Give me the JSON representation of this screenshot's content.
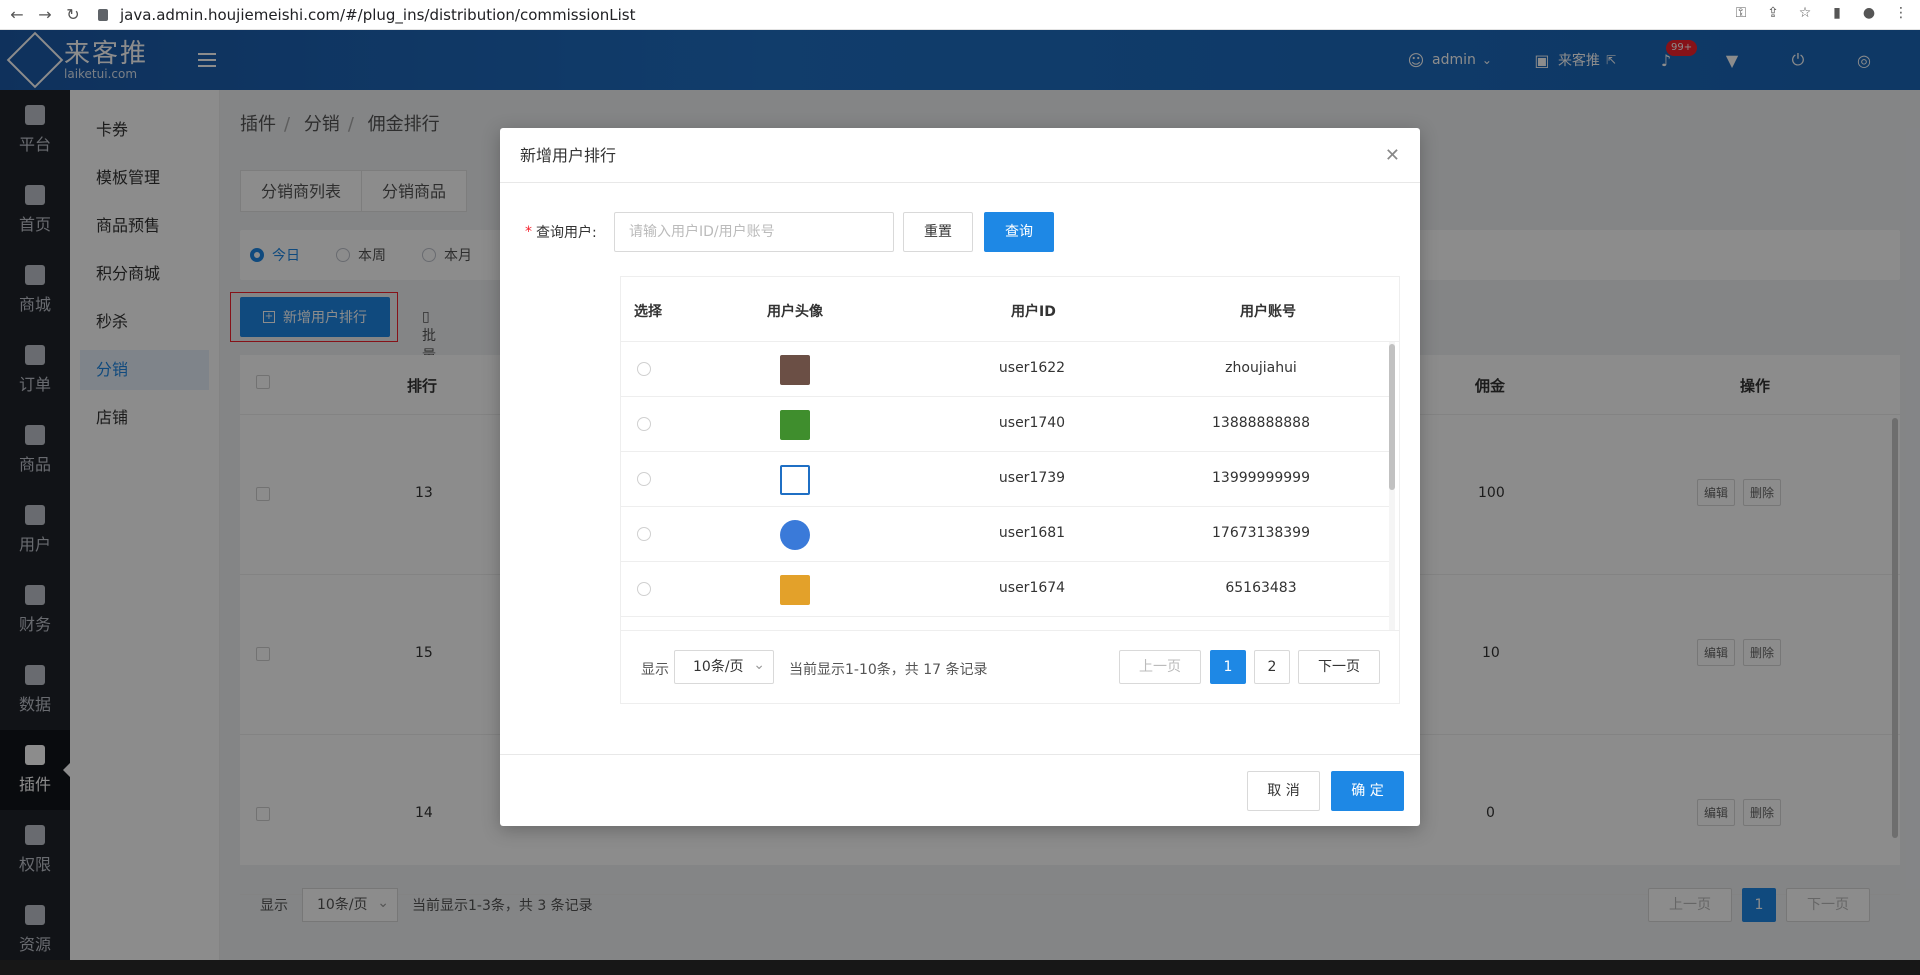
{
  "browser": {
    "url": "java.admin.houjiemeishi.com/#/plug_ins/distribution/commissionList"
  },
  "header": {
    "logo_cn": "来客推",
    "logo_en": "laiketui.com",
    "user": "admin",
    "store": "来客推",
    "notif_badge": "99+"
  },
  "sidebar": {
    "items": [
      {
        "label": "平台",
        "icon": "platform-icon"
      },
      {
        "label": "首页",
        "icon": "home-icon"
      },
      {
        "label": "商城",
        "icon": "mall-icon"
      },
      {
        "label": "订单",
        "icon": "order-icon"
      },
      {
        "label": "商品",
        "icon": "goods-icon"
      },
      {
        "label": "用户",
        "icon": "user-icon"
      },
      {
        "label": "财务",
        "icon": "wallet-icon"
      },
      {
        "label": "数据",
        "icon": "pie-chart-icon"
      },
      {
        "label": "插件",
        "icon": "puzzle-icon"
      },
      {
        "label": "权限",
        "icon": "shield-icon"
      },
      {
        "label": "资源",
        "icon": "image-icon"
      }
    ]
  },
  "submenu": {
    "items": [
      "卡券",
      "模板管理",
      "商品预售",
      "积分商城",
      "秒杀",
      "分销",
      "店铺"
    ]
  },
  "breadcrumb": [
    "插件",
    "分销",
    "佣金排行"
  ],
  "tabs": [
    "分销商列表",
    "分销商品"
  ],
  "filter": [
    "今日",
    "本周",
    "本月"
  ],
  "actions": {
    "add": "新增用户排行",
    "batch_delete": "批量删除"
  },
  "bg_table": {
    "headers": {
      "rank": "排行",
      "commission": "佣金",
      "op": "操作"
    },
    "rows": [
      {
        "rank": "13",
        "commission": "100"
      },
      {
        "rank": "15",
        "commission": "10"
      },
      {
        "rank": "14",
        "commission": "0"
      }
    ],
    "edit": "编辑",
    "delete": "删除"
  },
  "bg_pager": {
    "show": "显示",
    "page_size": "10条/页",
    "info": "当前显示1-3条，共 3 条记录",
    "prev": "上一页",
    "page": "1",
    "next": "下一页"
  },
  "modal": {
    "title": "新增用户排行",
    "query_label": "查询用户:",
    "query_placeholder": "请输入用户ID/用户账号",
    "reset": "重置",
    "search": "查询",
    "headers": {
      "select": "选择",
      "avatar": "用户头像",
      "uid": "用户ID",
      "account": "用户账号"
    },
    "rows": [
      {
        "uid": "user1622",
        "account": "zhoujiahui",
        "avatar_color": "#6b4f45"
      },
      {
        "uid": "user1740",
        "account": "13888888888",
        "avatar_color": "#3f8e2d"
      },
      {
        "uid": "user1739",
        "account": "13999999999",
        "avatar_color": "#ffffff"
      },
      {
        "uid": "user1681",
        "account": "17673138399",
        "avatar_color": "#3a7ad9"
      },
      {
        "uid": "user1674",
        "account": "65163483",
        "avatar_color": "#e3a12a"
      }
    ],
    "pager": {
      "show": "显示",
      "page_size": "10条/页",
      "info": "当前显示1-10条，共 17 条记录",
      "prev": "上一页",
      "p1": "1",
      "p2": "2",
      "next": "下一页"
    },
    "cancel": "取 消",
    "ok": "确 定"
  }
}
